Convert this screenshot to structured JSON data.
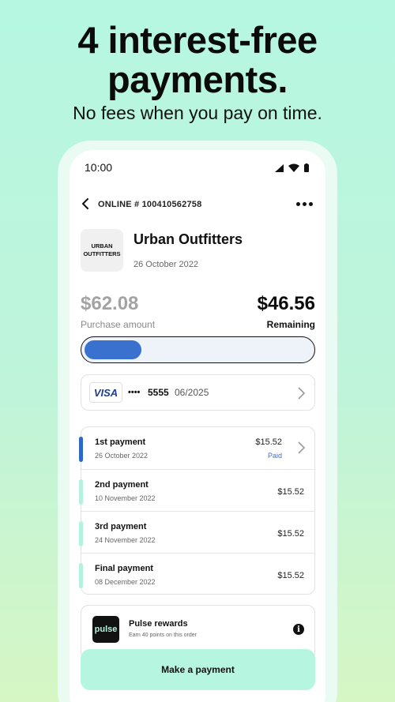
{
  "promo": {
    "headline_line1": "4 interest-free",
    "headline_line2": "payments.",
    "subline": "No fees when you pay on time."
  },
  "status_bar": {
    "time": "10:00"
  },
  "order": {
    "label": "ONLINE # 100410562758",
    "merchant_logo_line1": "URBAN",
    "merchant_logo_line2": "OUTFITTERS",
    "merchant_name": "Urban Outfitters",
    "date": "26 October 2022"
  },
  "amounts": {
    "purchase": "$62.08",
    "purchase_label": "Purchase amount",
    "remaining": "$46.56",
    "remaining_label": "Remaining",
    "paid_fraction": 0.25
  },
  "card": {
    "brand": "VISA",
    "dots": "••••",
    "last4": "5555",
    "expiry": "06/2025"
  },
  "payments": [
    {
      "title": "1st payment",
      "date": "26 October 2022",
      "amount": "$15.52",
      "status": "Paid"
    },
    {
      "title": "2nd payment",
      "date": "10 November 2022",
      "amount": "$15.52",
      "status": ""
    },
    {
      "title": "3rd payment",
      "date": "24 November 2022",
      "amount": "$15.52",
      "status": ""
    },
    {
      "title": "Final payment",
      "date": "08 December 2022",
      "amount": "$15.52",
      "status": ""
    }
  ],
  "rewards": {
    "logo_text": "pulse",
    "title": "Pulse rewards",
    "subtitle": "Earn 40 points on this order"
  },
  "cta": {
    "label": "Make a payment"
  },
  "colors": {
    "accent_mint": "#b6f5e0",
    "accent_blue": "#3a71cf"
  }
}
